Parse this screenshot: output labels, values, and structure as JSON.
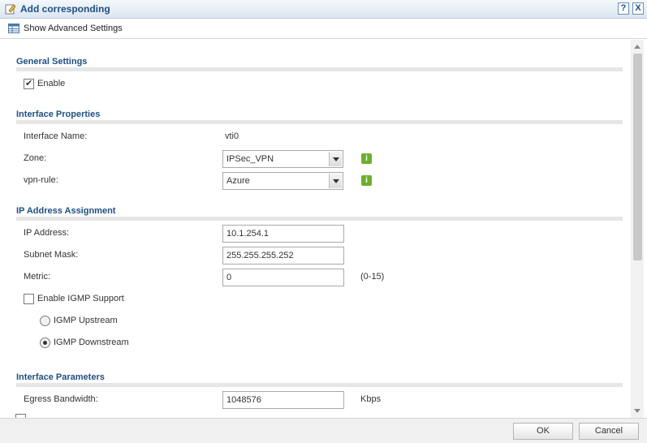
{
  "window": {
    "title": "Add corresponding",
    "help_label": "?",
    "close_label": "X"
  },
  "toolbar": {
    "advanced_label": "Show Advanced Settings"
  },
  "general": {
    "title": "General Settings",
    "enable_label": "Enable",
    "enable_checked": true
  },
  "interface": {
    "title": "Interface Properties",
    "name_label": "Interface Name:",
    "name_value": "vti0",
    "zone_label": "Zone:",
    "zone_value": "IPSec_VPN",
    "vpnrule_label": "vpn-rule:",
    "vpnrule_value": "Azure"
  },
  "ip": {
    "title": "IP Address Assignment",
    "address_label": "IP Address:",
    "address_value": "10.1.254.1",
    "mask_label": "Subnet Mask:",
    "mask_value": "255.255.255.252",
    "metric_label": "Metric:",
    "metric_value": "0",
    "metric_range": "(0-15)",
    "igmp_label": "Enable IGMP Support",
    "igmp_checked": false,
    "upstream_label": "IGMP Upstream",
    "downstream_label": "IGMP Downstream",
    "selected_mode": "downstream"
  },
  "params": {
    "title": "Interface Parameters",
    "egress_label": "Egress Bandwidth:",
    "egress_value": "1048576",
    "egress_unit": "Kbps"
  },
  "footer": {
    "ok_label": "OK",
    "cancel_label": "Cancel"
  },
  "icons": {
    "info": "info-icon",
    "edit": "edit-icon",
    "table": "table-icon"
  },
  "colors": {
    "accent": "#1e4f83",
    "info_green": "#6fae2f"
  }
}
